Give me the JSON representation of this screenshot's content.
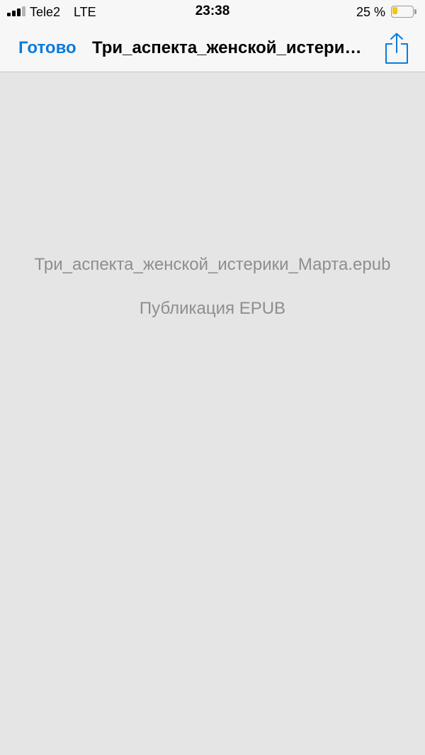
{
  "status_bar": {
    "carrier": "Tele2",
    "network": "LTE",
    "time": "23:38",
    "battery_percent": "25 %",
    "battery_level": 0.25,
    "signal_bars_active": 3,
    "signal_bars_total": 4,
    "battery_color": "#f5c518"
  },
  "nav_bar": {
    "done_label": "Готово",
    "title": "Три_аспекта_женской_истерики_Марта.epub",
    "share_icon": "share-icon",
    "accent_color": "#0a7bdc"
  },
  "document": {
    "file_name": "Три_аспекта_женской_истерики_Марта.epub",
    "file_type": "Публикация EPUB"
  }
}
